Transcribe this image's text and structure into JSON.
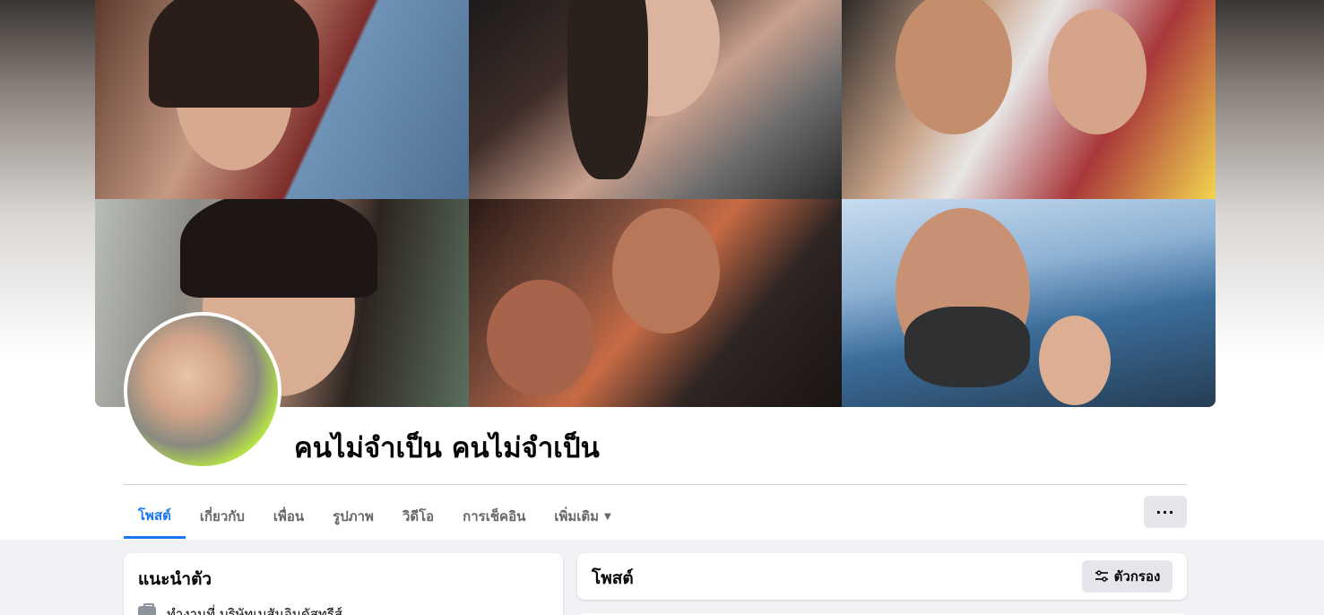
{
  "profile": {
    "name": "คนไม่จำเป็น คนไม่จำเป็น"
  },
  "tabs": [
    {
      "label": "โพสต์",
      "active": true
    },
    {
      "label": "เกี่ยวกับ",
      "active": false
    },
    {
      "label": "เพื่อน",
      "active": false
    },
    {
      "label": "รูปภาพ",
      "active": false
    },
    {
      "label": "วิดีโอ",
      "active": false
    },
    {
      "label": "การเช็คอิน",
      "active": false
    },
    {
      "label": "เพิ่มเติม",
      "active": false
    }
  ],
  "more_button": {
    "label": "···"
  },
  "intro": {
    "title": "แนะนำตัว",
    "work": "ทำงานที่ บริษัทเมสันอินดัสทรีส์"
  },
  "posts": {
    "title": "โพสต์",
    "filter_label": "ตัวกรอง"
  },
  "colors": {
    "accent": "#1877f2",
    "background": "#f0f2f5",
    "button": "#e4e6eb"
  }
}
